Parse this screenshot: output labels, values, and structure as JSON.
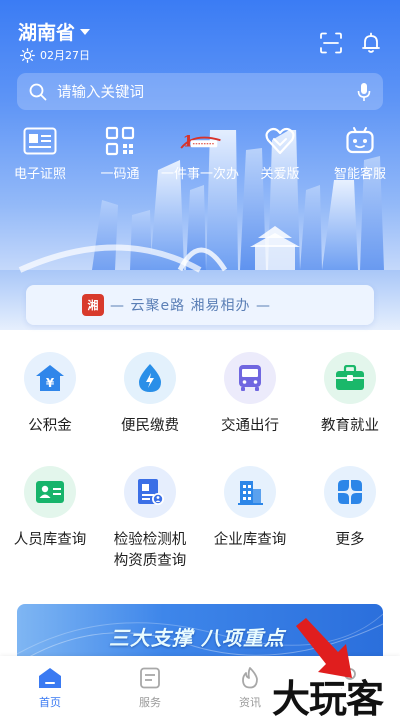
{
  "header": {
    "province": "湖南省",
    "date": "02月27日",
    "search_placeholder": "请输入关键词"
  },
  "quick_entries": [
    {
      "label": "电子证照",
      "icon": "id-card-icon"
    },
    {
      "label": "一码通",
      "icon": "qr-code-icon"
    },
    {
      "label": "一件事一次办",
      "icon": "one-thing-logo-icon"
    },
    {
      "label": "关爱版",
      "icon": "heart-care-icon"
    },
    {
      "label": "智能客服",
      "icon": "robot-service-icon"
    }
  ],
  "slogan": {
    "logo_text": "湘",
    "text": "— 云聚e路  湘易相办 —"
  },
  "services": [
    {
      "label": "公积金",
      "icon": "housing-fund-icon",
      "bg": "#e6f1fd",
      "color": "#2f86ea"
    },
    {
      "label": "便民缴费",
      "icon": "water-drop-icon",
      "bg": "#e3f1fc",
      "color": "#2a8fe8"
    },
    {
      "label": "交通出行",
      "icon": "bus-icon",
      "bg": "#ecebfb",
      "color": "#7067e0"
    },
    {
      "label": "教育就业",
      "icon": "briefcase-icon",
      "bg": "#e3f6ec",
      "color": "#1ab86a"
    },
    {
      "label": "人员库查询",
      "icon": "person-card-icon",
      "bg": "#e3f6ec",
      "color": "#17b46b"
    },
    {
      "label": "检验检测机\n构资质查询",
      "icon": "certificate-icon",
      "bg": "#e6eefd",
      "color": "#3b6fe6"
    },
    {
      "label": "企业库查询",
      "icon": "building-icon",
      "bg": "#e6f1fd",
      "color": "#2c86e8"
    },
    {
      "label": "更多",
      "icon": "more-grid-icon",
      "bg": "#e6f1fd",
      "color": "#2c86e8"
    }
  ],
  "promo": {
    "text": "三大支撑 八项重点"
  },
  "tabs": [
    {
      "label": "首页",
      "icon": "home-icon",
      "active": true
    },
    {
      "label": "服务",
      "icon": "service-doc-icon",
      "active": false
    },
    {
      "label": "资讯",
      "icon": "news-flame-icon",
      "active": false
    },
    {
      "label": "",
      "icon": "profile-icon",
      "active": false
    }
  ],
  "watermark": "大玩客",
  "colors": {
    "primary": "#3a7af2",
    "hero_top": "#3b7cf4"
  }
}
